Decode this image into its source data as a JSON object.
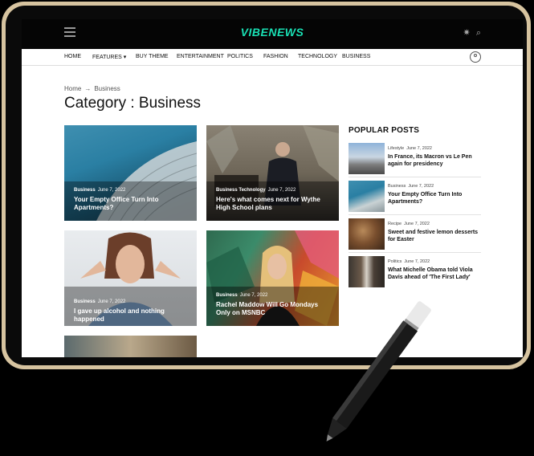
{
  "header": {
    "logo": "VIBENEWS",
    "icons": [
      "menu-icon",
      "sun-icon",
      "search-icon",
      "user-icon"
    ]
  },
  "nav": {
    "items": [
      "HOME",
      "FEATURES ▾",
      "BUY THEME",
      "ENTERTAINMENT",
      "POLITICS",
      "FASHION",
      "TECHNOLOGY",
      "BUSINESS"
    ]
  },
  "breadcrumb": {
    "home": "Home",
    "current": "Business"
  },
  "page": {
    "title": "Category : Business"
  },
  "articles": [
    {
      "category": "Business",
      "date": "June 7, 2022",
      "title": "Your Empty Office Turn Into Apartments?"
    },
    {
      "category": "Business Technology",
      "date": "June 7, 2022",
      "title": "Here's what comes next for Wythe High School plans"
    },
    {
      "category": "Business",
      "date": "June 7, 2022",
      "title": "I gave up alcohol and nothing happened"
    },
    {
      "category": "Business",
      "date": "June 7, 2022",
      "title": "Rachel Maddow Will Go Mondays Only on MSNBC"
    }
  ],
  "popular": {
    "heading": "POPULAR POSTS",
    "items": [
      {
        "category": "Lifestyle",
        "date": "June 7, 2022",
        "title": "In France, its Macron vs Le Pen again for presidency"
      },
      {
        "category": "Business",
        "date": "June 7, 2022",
        "title": "Your Empty Office Turn Into Apartments?"
      },
      {
        "category": "Recipe",
        "date": "June 7, 2022",
        "title": "Sweet and festive lemon desserts for Easter"
      },
      {
        "category": "Politics",
        "date": "June 7, 2022",
        "title": "What Michelle Obama told Viola Davis ahead of 'The First Lady'"
      }
    ]
  },
  "colors": {
    "brand": "#19e0b4",
    "frame": "#d7c4a0",
    "background": "#000000"
  }
}
